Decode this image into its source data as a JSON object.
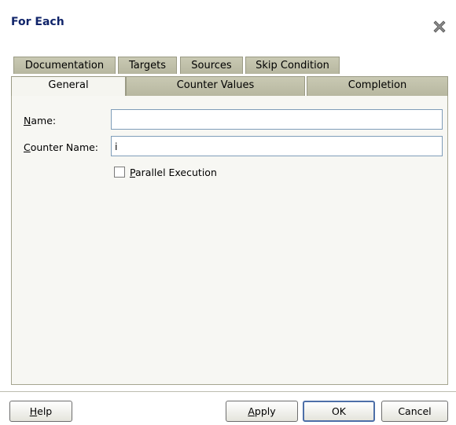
{
  "dialog": {
    "title": "For Each"
  },
  "tabs_back": [
    "Documentation",
    "Targets",
    "Sources",
    "Skip Condition"
  ],
  "tabs_front": [
    "General",
    "Counter Values",
    "Completion"
  ],
  "general": {
    "name_label_u": "N",
    "name_label_rest": "ame:",
    "name_value": "",
    "counter_label_u": "C",
    "counter_label_rest": "ounter Name:",
    "counter_value": "i",
    "parallel_u": "P",
    "parallel_rest": "arallel Execution",
    "parallel_checked": false
  },
  "buttons": {
    "help_u": "H",
    "help_rest": "elp",
    "apply_u": "A",
    "apply_rest": "pply",
    "ok": "OK",
    "cancel": "Cancel"
  },
  "colors": {
    "title": "#10246a",
    "default_border": "#4d6fa8"
  },
  "icons": {
    "close": "close-x-icon"
  }
}
